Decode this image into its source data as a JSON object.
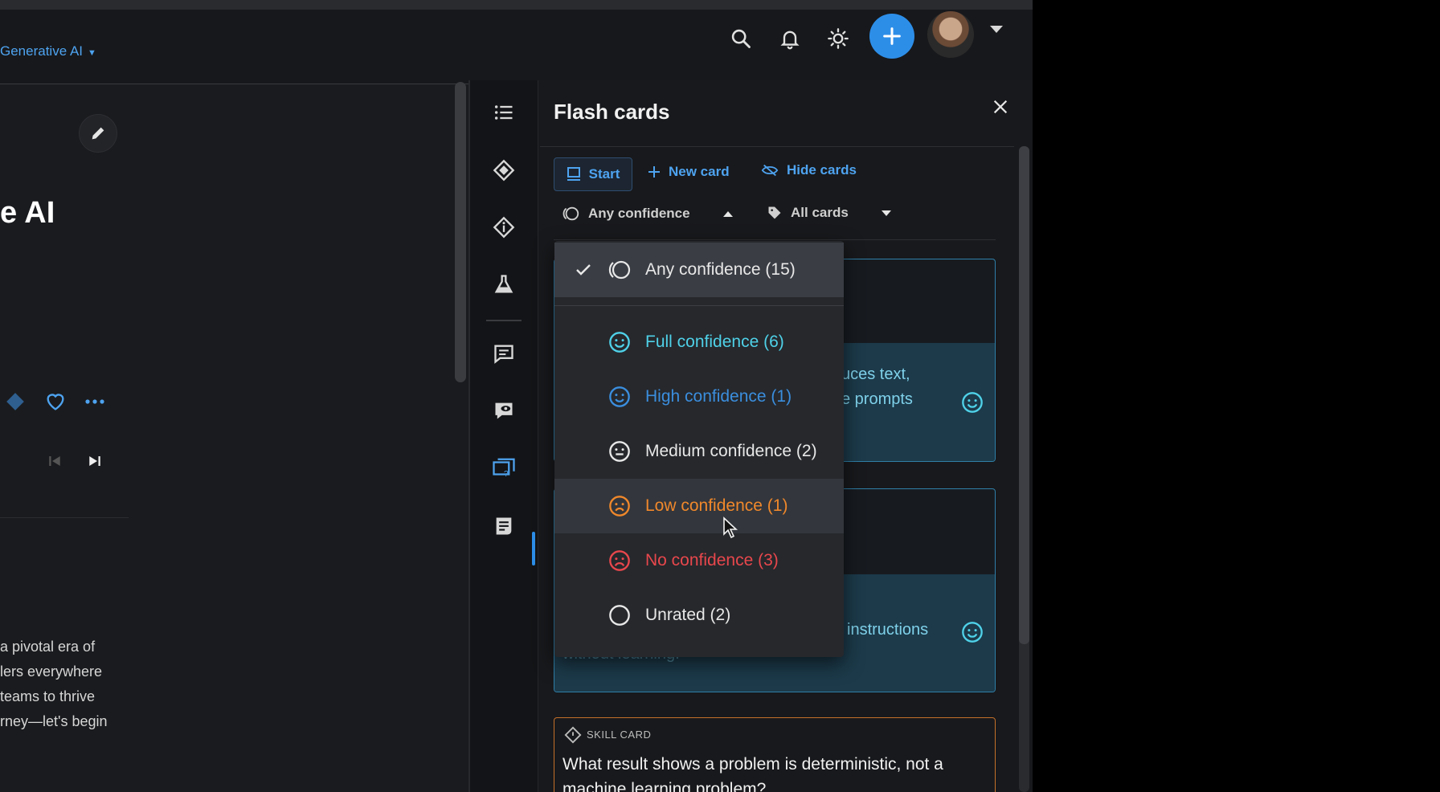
{
  "header": {
    "breadcrumb": "Generative AI",
    "icons": [
      "search-icon",
      "bell-icon",
      "brightness-icon",
      "plus-icon",
      "user-avatar",
      "chevron-down-icon"
    ]
  },
  "left": {
    "title": "e AI",
    "body_lines": [
      "a pivotal era of",
      "lers everywhere",
      "teams to thrive",
      "rney—let's begin"
    ]
  },
  "rail": {
    "icons": [
      "list-icon",
      "path-icon",
      "diamond-info-icon",
      "flask-icon",
      "chat-icon",
      "chat-eye-icon",
      "flashcards-icon",
      "notes-icon"
    ]
  },
  "panel": {
    "title": "Flash cards",
    "toolbar": {
      "start": "Start",
      "new_card": "New card",
      "hide_cards": "Hide cards"
    },
    "filters": {
      "confidence": "Any confidence",
      "cards": "All cards"
    },
    "cards": [
      {
        "snippet_1": "uces text,",
        "snippet_2": "e prompts"
      },
      {
        "snippet_1": "instructions",
        "snippet_2": "without learning."
      }
    ],
    "skill_card": {
      "label": "SKILL CARD",
      "question": "What result shows a problem is deterministic, not a machine learning problem?"
    }
  },
  "dropdown": {
    "items": [
      {
        "label": "Any confidence (15)",
        "icon": "any-confidence-icon",
        "color": "#e8e8e8",
        "selected": true
      },
      {
        "label": "Full confidence (6)",
        "icon": "smile-icon",
        "color": "#4fd1e8"
      },
      {
        "label": "High confidence (1)",
        "icon": "smile-icon",
        "color": "#3b8ede"
      },
      {
        "label": "Medium confidence (2)",
        "icon": "neutral-face-icon",
        "color": "#e8e8e8"
      },
      {
        "label": "Low confidence (1)",
        "icon": "frown-icon",
        "color": "#f0882b",
        "hovered": true
      },
      {
        "label": "No confidence (3)",
        "icon": "sad-face-icon",
        "color": "#e8474c"
      },
      {
        "label": "Unrated (2)",
        "icon": "circle-icon",
        "color": "#e8e8e8"
      }
    ]
  },
  "colors": {
    "accent": "#2d8ee8",
    "link": "#4ea3f0",
    "card_border": "#2f7fa8",
    "skill_border": "#c5702a"
  }
}
